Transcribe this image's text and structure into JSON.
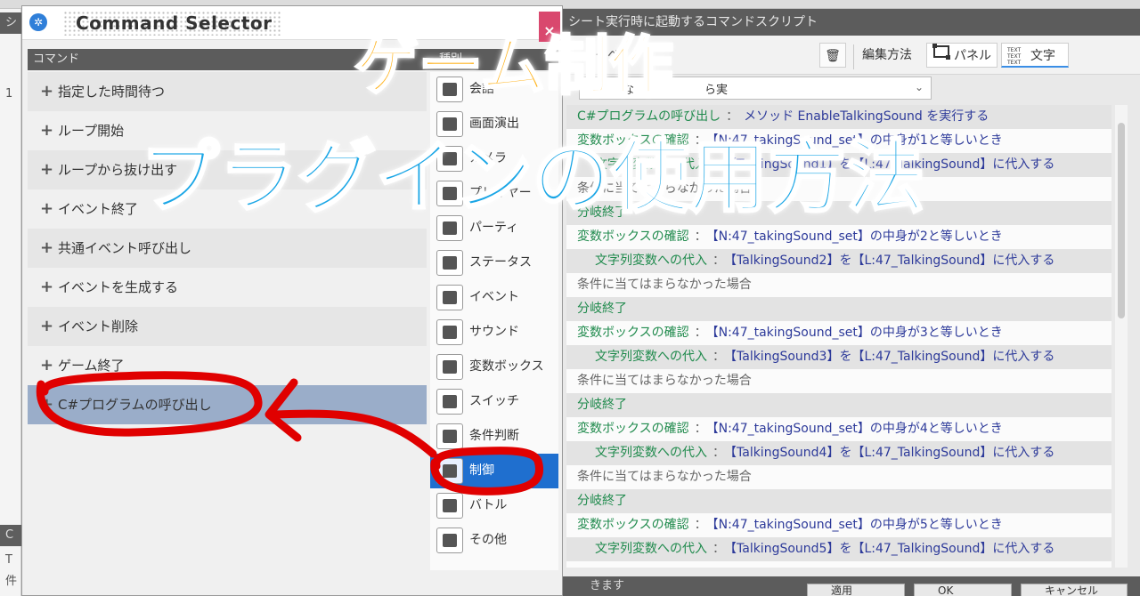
{
  "overlay": {
    "title_line1": "ゲーム制作",
    "title_line2": "プラグインの使用方法"
  },
  "background_editor": {
    "left_strip": [
      "シ",
      "1",
      "C",
      "T",
      "件"
    ],
    "script_header": "シート実行時に起動するコマンドスクリプト",
    "toolbar": {
      "prefix_label": "イベ",
      "edit_mode_label": "編集方法",
      "panel_label": "パネル",
      "text_label": "文字",
      "text_icon_lines": [
        "TEXT",
        "TEXT",
        "TEXT"
      ]
    },
    "combo_text": "な",
    "combo_suffix": "ら実",
    "script_lines": [
      {
        "indent": 0,
        "shade": true,
        "parts": [
          [
            "k",
            "C#プログラムの呼び出し"
          ],
          [
            "g",
            "："
          ],
          [
            "v",
            "メソッド EnableTalkingSound を実行する"
          ]
        ]
      },
      {
        "indent": 0,
        "shade": false,
        "parts": [
          [
            "k",
            "変数ボックスの確認"
          ],
          [
            "g",
            "："
          ],
          [
            "v",
            "【N:47_takingSound_set】の中身が1と等しいとき"
          ]
        ]
      },
      {
        "indent": 1,
        "shade": true,
        "parts": [
          [
            "k",
            "文字列変数への代入"
          ],
          [
            "g",
            "："
          ],
          [
            "v",
            "【TalkingSound1】を【L:47_TalkingSound】に代入する"
          ]
        ]
      },
      {
        "indent": 0,
        "shade": false,
        "parts": [
          [
            "g",
            "条件に当てはまらなかった場合"
          ]
        ]
      },
      {
        "indent": 0,
        "shade": true,
        "parts": [
          [
            "k",
            "分岐終了"
          ]
        ]
      },
      {
        "indent": 0,
        "shade": false,
        "parts": [
          [
            "k",
            "変数ボックスの確認"
          ],
          [
            "g",
            "："
          ],
          [
            "v",
            "【N:47_takingSound_set】の中身が2と等しいとき"
          ]
        ]
      },
      {
        "indent": 1,
        "shade": true,
        "parts": [
          [
            "k",
            "文字列変数への代入"
          ],
          [
            "g",
            "："
          ],
          [
            "v",
            "【TalkingSound2】を【L:47_TalkingSound】に代入する"
          ]
        ]
      },
      {
        "indent": 0,
        "shade": false,
        "parts": [
          [
            "g",
            "条件に当てはまらなかった場合"
          ]
        ]
      },
      {
        "indent": 0,
        "shade": true,
        "parts": [
          [
            "k",
            "分岐終了"
          ]
        ]
      },
      {
        "indent": 0,
        "shade": false,
        "parts": [
          [
            "k",
            "変数ボックスの確認"
          ],
          [
            "g",
            "："
          ],
          [
            "v",
            "【N:47_takingSound_set】の中身が3と等しいとき"
          ]
        ]
      },
      {
        "indent": 1,
        "shade": true,
        "parts": [
          [
            "k",
            "文字列変数への代入"
          ],
          [
            "g",
            "："
          ],
          [
            "v",
            "【TalkingSound3】を【L:47_TalkingSound】に代入する"
          ]
        ]
      },
      {
        "indent": 0,
        "shade": false,
        "parts": [
          [
            "g",
            "条件に当てはまらなかった場合"
          ]
        ]
      },
      {
        "indent": 0,
        "shade": true,
        "parts": [
          [
            "k",
            "分岐終了"
          ]
        ]
      },
      {
        "indent": 0,
        "shade": false,
        "parts": [
          [
            "k",
            "変数ボックスの確認"
          ],
          [
            "g",
            "："
          ],
          [
            "v",
            "【N:47_takingSound_set】の中身が4と等しいとき"
          ]
        ]
      },
      {
        "indent": 1,
        "shade": true,
        "parts": [
          [
            "k",
            "文字列変数への代入"
          ],
          [
            "g",
            "："
          ],
          [
            "v",
            "【TalkingSound4】を【L:47_TalkingSound】に代入する"
          ]
        ]
      },
      {
        "indent": 0,
        "shade": false,
        "parts": [
          [
            "g",
            "条件に当てはまらなかった場合"
          ]
        ]
      },
      {
        "indent": 0,
        "shade": true,
        "parts": [
          [
            "k",
            "分岐終了"
          ]
        ]
      },
      {
        "indent": 0,
        "shade": false,
        "parts": [
          [
            "k",
            "変数ボックスの確認"
          ],
          [
            "g",
            "："
          ],
          [
            "v",
            "【N:47_takingSound_set】の中身が5と等しいとき"
          ]
        ]
      },
      {
        "indent": 1,
        "shade": true,
        "parts": [
          [
            "k",
            "文字列変数への代入"
          ],
          [
            "g",
            "："
          ],
          [
            "v",
            "【TalkingSound5】を【L:47_TalkingSound】に代入する"
          ]
        ]
      }
    ],
    "bottom_text": "きます",
    "bottom_buttons": {
      "apply": "適用",
      "ok": "OK",
      "cancel": "キャンセル"
    }
  },
  "command_selector": {
    "title": "Command Selector",
    "close_glyph": "×",
    "command_header": "コマンド",
    "category_header": "種別",
    "commands": [
      {
        "label": "指定した時間待つ",
        "state": "alt"
      },
      {
        "label": "ループ開始",
        "state": ""
      },
      {
        "label": "ループから抜け出す",
        "state": "alt"
      },
      {
        "label": "イベント終了",
        "state": ""
      },
      {
        "label": "共通イベント呼び出し",
        "state": "alt"
      },
      {
        "label": "イベントを生成する",
        "state": ""
      },
      {
        "label": "イベント削除",
        "state": "alt"
      },
      {
        "label": "ゲーム終了",
        "state": ""
      },
      {
        "label": "C#プログラムの呼び出し",
        "state": "sel"
      }
    ],
    "categories": [
      {
        "label": "会話",
        "icon": "speech-bubble-icon"
      },
      {
        "label": "画面演出",
        "icon": "monitor-icon"
      },
      {
        "label": "カメラ",
        "icon": "camera-icon"
      },
      {
        "label": "プレイヤー",
        "icon": "player-icon"
      },
      {
        "label": "パーティ",
        "icon": "party-icon"
      },
      {
        "label": "ステータス",
        "icon": "status-icon"
      },
      {
        "label": "イベント",
        "icon": "event-icon"
      },
      {
        "label": "サウンド",
        "icon": "music-note-icon"
      },
      {
        "label": "変数ボックス",
        "icon": "variable-box-icon"
      },
      {
        "label": "スイッチ",
        "icon": "switch-icon"
      },
      {
        "label": "条件判断",
        "icon": "branch-icon"
      },
      {
        "label": "制御",
        "icon": "control-icon",
        "selected": true
      },
      {
        "label": "バトル",
        "icon": "battle-icon"
      },
      {
        "label": "その他",
        "icon": "other-icon"
      }
    ]
  },
  "colors": {
    "title_orange": "#ffb21a",
    "title_blue": "#1aa6e6",
    "annotation_red": "#e00000",
    "selected_category": "#1f6fcf",
    "selected_command": "#9aadc9"
  }
}
